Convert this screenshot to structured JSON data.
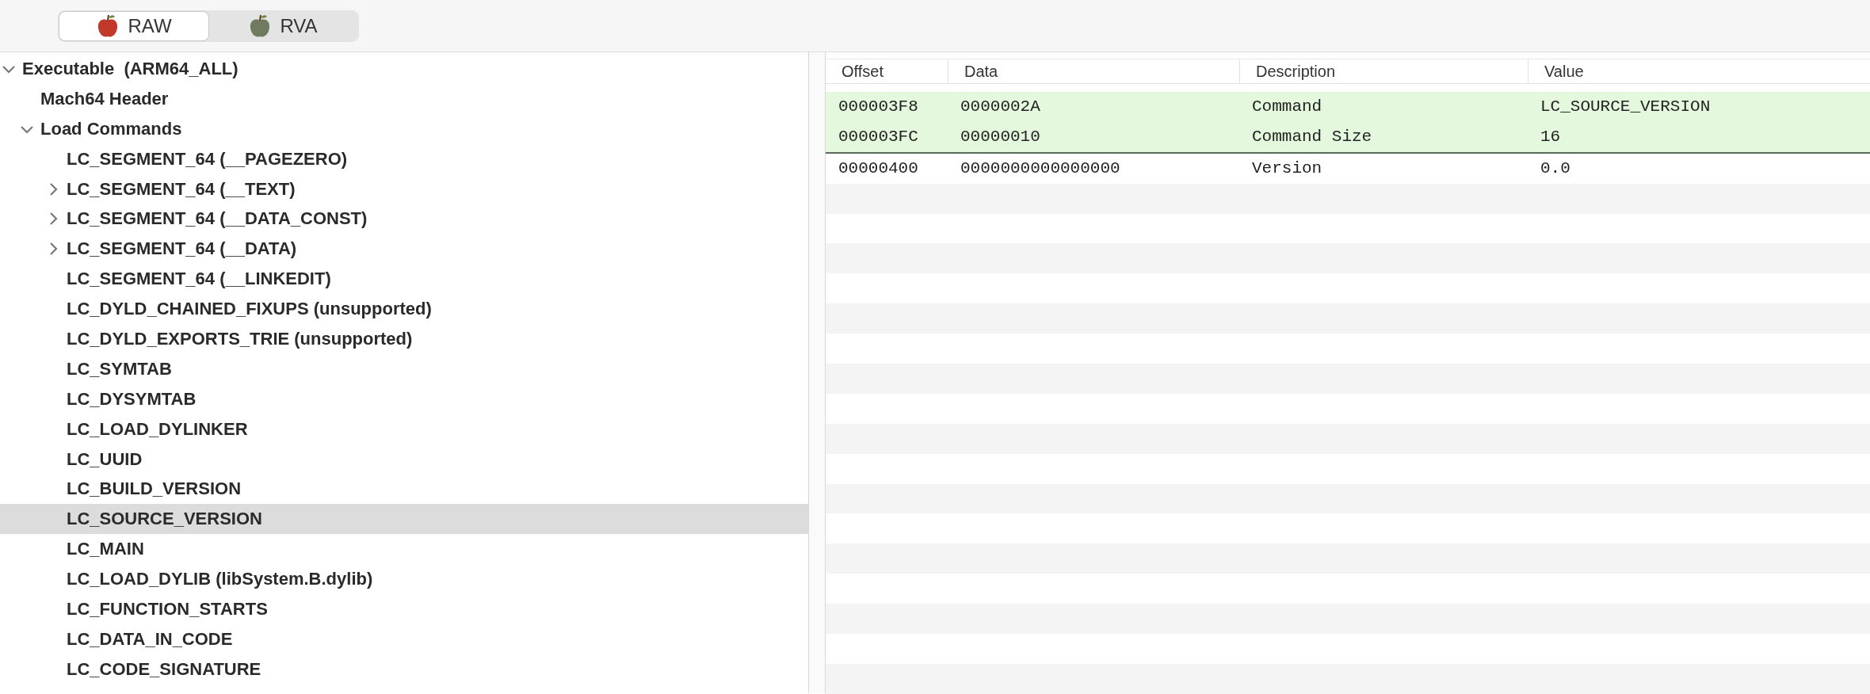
{
  "mode_switch": [
    {
      "label": "RAW",
      "selected": true
    },
    {
      "label": "RVA",
      "selected": false
    }
  ],
  "tree": [
    {
      "label": "Executable  (ARM64_ALL)",
      "expanded": true,
      "selected": false,
      "children": [
        {
          "label": "Mach64 Header",
          "selected": false
        },
        {
          "label": "Load Commands",
          "expanded": true,
          "selected": false,
          "children": [
            {
              "label": "LC_SEGMENT_64 (__PAGEZERO)",
              "selected": false
            },
            {
              "label": "LC_SEGMENT_64 (__TEXT)",
              "expanded": false,
              "selected": false
            },
            {
              "label": "LC_SEGMENT_64 (__DATA_CONST)",
              "expanded": false,
              "selected": false
            },
            {
              "label": "LC_SEGMENT_64 (__DATA)",
              "expanded": false,
              "selected": false
            },
            {
              "label": "LC_SEGMENT_64 (__LINKEDIT)",
              "selected": false
            },
            {
              "label": "LC_DYLD_CHAINED_FIXUPS (unsupported)",
              "selected": false
            },
            {
              "label": "LC_DYLD_EXPORTS_TRIE (unsupported)",
              "selected": false
            },
            {
              "label": "LC_SYMTAB",
              "selected": false
            },
            {
              "label": "LC_DYSYMTAB",
              "selected": false
            },
            {
              "label": "LC_LOAD_DYLINKER",
              "selected": false
            },
            {
              "label": "LC_UUID",
              "selected": false
            },
            {
              "label": "LC_BUILD_VERSION",
              "selected": false
            },
            {
              "label": "LC_SOURCE_VERSION",
              "selected": true
            },
            {
              "label": "LC_MAIN",
              "selected": false
            },
            {
              "label": "LC_LOAD_DYLIB (libSystem.B.dylib)",
              "selected": false
            },
            {
              "label": "LC_FUNCTION_STARTS",
              "selected": false
            },
            {
              "label": "LC_DATA_IN_CODE",
              "selected": false
            },
            {
              "label": "LC_CODE_SIGNATURE",
              "selected": false
            }
          ]
        }
      ]
    }
  ],
  "table": {
    "columns": [
      "Offset",
      "Data",
      "Description",
      "Value"
    ],
    "rows": [
      {
        "cells": [
          "000003F8",
          "0000002A",
          "Command",
          "LC_SOURCE_VERSION"
        ],
        "highlighted": true
      },
      {
        "cells": [
          "000003FC",
          "00000010",
          "Command Size",
          "16"
        ],
        "highlighted": true
      },
      {
        "cells": [
          "00000400",
          "0000000000000000",
          "Version",
          "0.0"
        ],
        "highlighted": false
      }
    ]
  }
}
